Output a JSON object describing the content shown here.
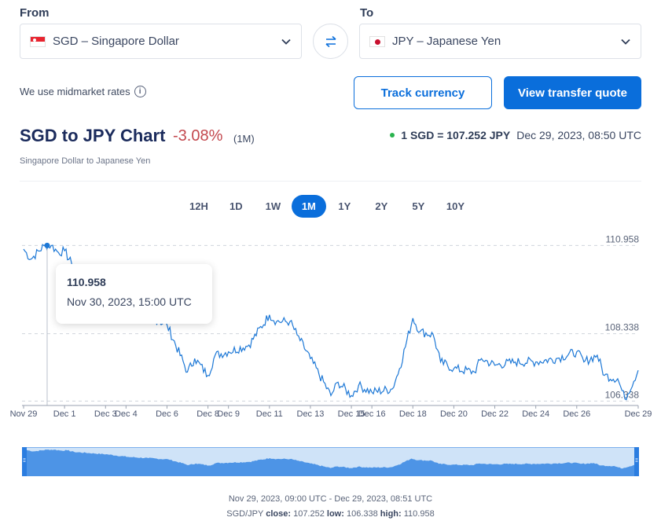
{
  "converter": {
    "from_label": "From",
    "to_label": "To",
    "from_value": "SGD – Singapore Dollar",
    "to_value": "JPY – Japanese Yen",
    "from_flag": "singapore-flag",
    "to_flag": "japan-flag"
  },
  "midmarket_text": "We use midmarket rates",
  "buttons": {
    "track": "Track currency",
    "quote": "View transfer quote"
  },
  "header": {
    "title": "SGD to JPY Chart",
    "change": "-3.08%",
    "period": "(1M)",
    "subtitle": "Singapore Dollar to Japanese Yen",
    "rate": "1 SGD = 107.252 JPY",
    "timestamp": "Dec 29, 2023, 08:50 UTC"
  },
  "ranges": [
    "12H",
    "1D",
    "1W",
    "1M",
    "1Y",
    "2Y",
    "5Y",
    "10Y"
  ],
  "active_range": "1M",
  "tooltip": {
    "value": "110.958",
    "date": "Nov 30, 2023, 15:00 UTC"
  },
  "footer": {
    "range_text": "Nov 29, 2023, 09:00 UTC - Dec 29, 2023, 08:51 UTC",
    "pair": "SGD/JPY",
    "close_label": "close:",
    "close": "107.252",
    "low_label": "low:",
    "low": "106.338",
    "high_label": "high:",
    "high": "110.958"
  },
  "colors": {
    "accent": "#0a6edb",
    "line": "#1d78d6",
    "negative": "#c3484e",
    "navigator_fill": "#4d94e6",
    "navigator_bg": "#cfe3f8"
  },
  "chart_data": {
    "type": "line",
    "x_ticks": [
      "Nov 29",
      "Dec 1",
      "Dec 3",
      "Dec 4",
      "Dec 6",
      "Dec 8",
      "Dec 9",
      "Dec 11",
      "Dec 13",
      "Dec 15",
      "Dec 16",
      "Dec 18",
      "Dec 20",
      "Dec 22",
      "Dec 24",
      "Dec 26",
      "Dec 29"
    ],
    "y_ticks": [
      "110.958",
      "108.338",
      "106.338"
    ],
    "ylim": [
      106.3,
      111.2
    ],
    "series": [
      {
        "x": [
          "Nov 29",
          "Nov 29",
          "Nov 30",
          "Nov 30",
          "Nov 30",
          "Dec 1",
          "Dec 1",
          "Dec 3",
          "Dec 4",
          "Dec 5",
          "Dec 6",
          "Dec 7",
          "Dec 7",
          "Dec 8",
          "Dec 8",
          "Dec 9",
          "Dec 10",
          "Dec 11",
          "Dec 11",
          "Dec 12",
          "Dec 12",
          "Dec 13",
          "Dec 14",
          "Dec 14",
          "Dec 15",
          "Dec 15",
          "Dec 16",
          "Dec 17",
          "Dec 17",
          "Dec 18",
          "Dec 18",
          "Dec 19",
          "Dec 19",
          "Dec 20",
          "Dec 21",
          "Dec 21",
          "Dec 22",
          "Dec 23",
          "Dec 24",
          "Dec 25",
          "Dec 26",
          "Dec 26",
          "Dec 27",
          "Dec 27",
          "Dec 28",
          "Dec 28",
          "Dec 29"
        ],
        "y": [
          110.85,
          110.55,
          110.95,
          110.958,
          110.75,
          110.8,
          110.4,
          109.8,
          109.2,
          108.9,
          108.6,
          107.2,
          107.6,
          107.1,
          107.7,
          107.8,
          108.0,
          108.9,
          108.7,
          108.7,
          108.3,
          107.6,
          106.5,
          106.9,
          106.5,
          106.8,
          106.6,
          106.7,
          107.3,
          108.8,
          108.4,
          108.3,
          107.5,
          107.3,
          107.2,
          107.6,
          107.4,
          107.5,
          107.5,
          107.6,
          107.8,
          107.5,
          107.7,
          107.1,
          107.0,
          106.4,
          107.252
        ]
      }
    ]
  }
}
